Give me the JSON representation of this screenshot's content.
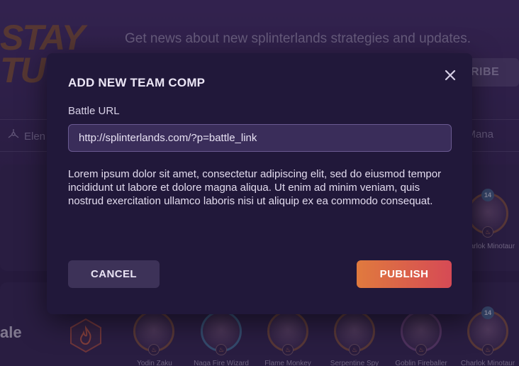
{
  "background": {
    "logo_lines": [
      "STAY",
      "TU"
    ],
    "tagline": "Get news about new splinterlands strategies and updates.",
    "subscribe_label": "RIBE",
    "filter_left_label": "Elen",
    "filter_right_label": "Mana",
    "card1_monster_name": "Charlok Minotaur",
    "card1_monster_level": "14",
    "card2_scale_label": "ale",
    "card2_monsters": [
      {
        "name": "Yodin Zaku",
        "level": ""
      },
      {
        "name": "Naga Fire Wizard",
        "level": ""
      },
      {
        "name": "Flame Monkey",
        "level": ""
      },
      {
        "name": "Serpentine Spy",
        "level": ""
      },
      {
        "name": "Goblin Fireballer",
        "level": ""
      },
      {
        "name": "Charlok Minotaur",
        "level": "14"
      }
    ]
  },
  "modal": {
    "title": "ADD NEW TEAM COMP",
    "field_label": "Battle URL",
    "url_value": "http://splinterlands.com/?p=battle_link",
    "description": "Lorem ipsum dolor sit amet, consectetur adipiscing elit, sed do eiusmod tempor incididunt ut labore et dolore magna aliqua. Ut enim ad minim veniam, quis nostrud exercitation ullamco laboris nisi ut aliquip ex ea commodo consequat.",
    "cancel_label": "CANCEL",
    "publish_label": "PUBLISH"
  },
  "colors": {
    "modal_bg": "#21183a",
    "input_bg": "#3a2d5a",
    "publish_gradient_start": "#e07a3e",
    "publish_gradient_end": "#d64a55",
    "cancel_bg": "#3d3258"
  }
}
